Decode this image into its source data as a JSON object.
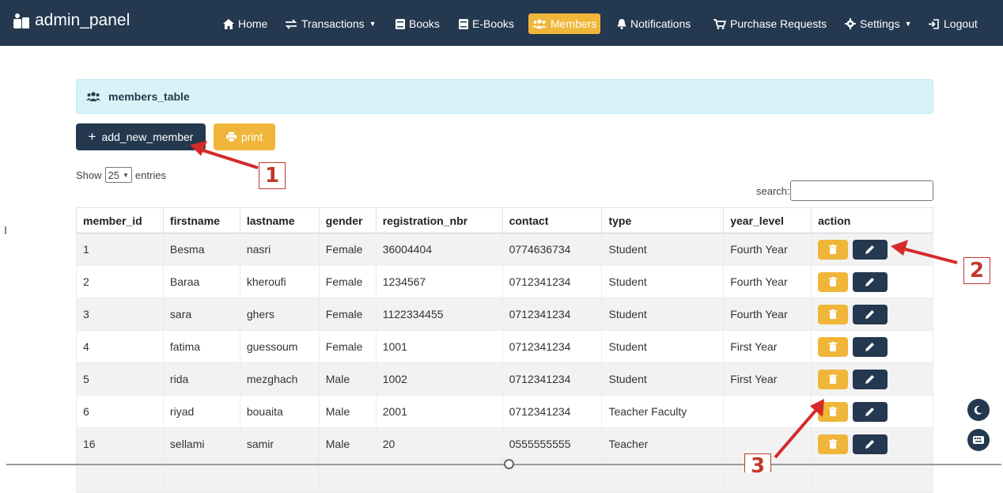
{
  "navbar": {
    "brand": "admin_panel",
    "items": [
      {
        "icon": "home-icon",
        "label": "Home"
      },
      {
        "icon": "exchange-icon",
        "label": "Transactions",
        "dropdown": true
      },
      {
        "icon": "book-icon",
        "label": "Books"
      },
      {
        "icon": "ebook-icon",
        "label": "E-Books"
      },
      {
        "icon": "users-icon",
        "label": "Members",
        "active": true
      },
      {
        "icon": "bell-icon",
        "label": "Notifications"
      },
      {
        "icon": "cart-icon",
        "label": "Purchase Requests"
      },
      {
        "icon": "gear-icon",
        "label": "Settings",
        "dropdown": true
      },
      {
        "icon": "logout-icon",
        "label": "Logout"
      }
    ]
  },
  "panel": {
    "title": "members_table"
  },
  "buttons": {
    "add": "add_new_member",
    "print": "print"
  },
  "table_controls": {
    "show": "Show",
    "page_size": "25",
    "entries": "entries",
    "search_label": "search:"
  },
  "table": {
    "columns": [
      "member_id",
      "firstname",
      "lastname",
      "gender",
      "registration_nbr",
      "contact",
      "type",
      "year_level",
      "action"
    ],
    "rows": [
      {
        "member_id": "1",
        "firstname": "Besma",
        "lastname": "nasri",
        "gender": "Female",
        "registration_nbr": "36004404",
        "contact": "0774636734",
        "type": "Student",
        "year_level": "Fourth Year"
      },
      {
        "member_id": "2",
        "firstname": "Baraa",
        "lastname": "kheroufi",
        "gender": "Female",
        "registration_nbr": "1234567",
        "contact": "0712341234",
        "type": "Student",
        "year_level": "Fourth Year"
      },
      {
        "member_id": "3",
        "firstname": "sara",
        "lastname": "ghers",
        "gender": "Female",
        "registration_nbr": "1122334455",
        "contact": "0712341234",
        "type": "Student",
        "year_level": "Fourth Year"
      },
      {
        "member_id": "4",
        "firstname": "fatima",
        "lastname": "guessoum",
        "gender": "Female",
        "registration_nbr": "1001",
        "contact": "0712341234",
        "type": "Student",
        "year_level": "First Year"
      },
      {
        "member_id": "5",
        "firstname": "rida",
        "lastname": "mezghach",
        "gender": "Male",
        "registration_nbr": "1002",
        "contact": "0712341234",
        "type": "Student",
        "year_level": "First Year"
      },
      {
        "member_id": "6",
        "firstname": "riyad",
        "lastname": "bouaita",
        "gender": "Male",
        "registration_nbr": "2001",
        "contact": "0712341234",
        "type": "Teacher Faculty",
        "year_level": ""
      },
      {
        "member_id": "16",
        "firstname": "sellami",
        "lastname": "samir",
        "gender": "Male",
        "registration_nbr": "20",
        "contact": "0555555555",
        "type": "Teacher",
        "year_level": ""
      }
    ]
  },
  "annotations": {
    "one": "1",
    "two": "2",
    "three": "3"
  },
  "colors": {
    "navbar": "#24384f",
    "accent": "#f0b63a",
    "annotation": "#c0392b",
    "alert_bg": "#d8f3f8"
  }
}
